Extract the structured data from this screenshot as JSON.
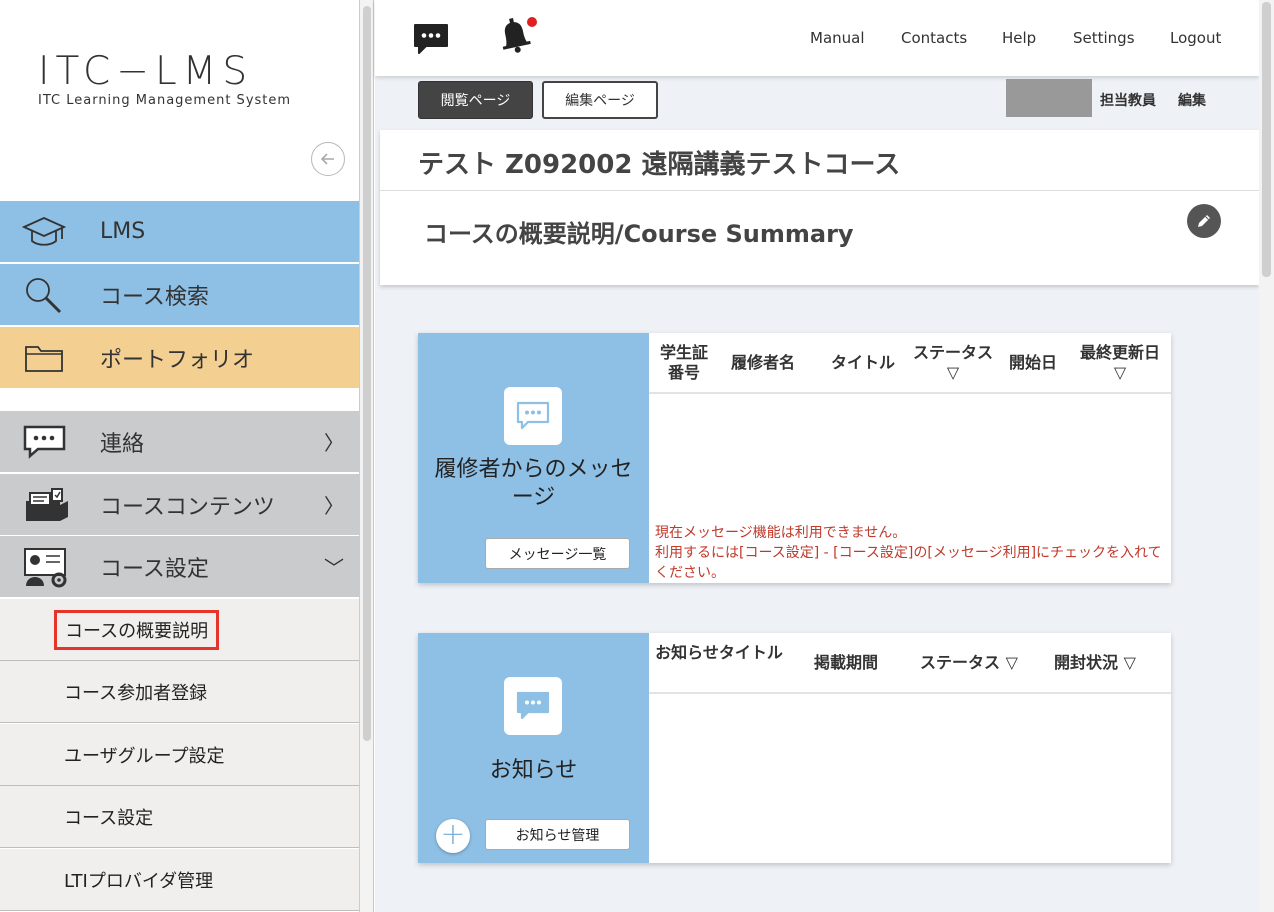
{
  "logo": {
    "main": "ITC−LMS",
    "sub": "ITC Learning Management System"
  },
  "sidebar": {
    "nav": [
      {
        "label": "LMS",
        "icon": "graduation-cap-icon"
      },
      {
        "label": "コース検索",
        "icon": "magnifier-icon"
      },
      {
        "label": "ポートフォリオ",
        "icon": "folder-icon"
      },
      {
        "label": "連絡",
        "icon": "chat-board-icon",
        "chevron": "〉"
      },
      {
        "label": "コースコンテンツ",
        "icon": "course-content-icon",
        "chevron": "〉"
      },
      {
        "label": "コース設定",
        "icon": "course-settings-icon",
        "chevron": "﹀"
      }
    ],
    "sub_items": [
      {
        "label": "コースの概要説明"
      },
      {
        "label": "コース参加者登録"
      },
      {
        "label": "ユーザグループ設定"
      },
      {
        "label": "コース設定"
      },
      {
        "label": "LTIプロバイダ管理"
      }
    ]
  },
  "header": {
    "links": [
      "Manual",
      "Contacts",
      "Help",
      "Settings",
      "Logout"
    ]
  },
  "toolbar": {
    "view_page": "閲覧ページ",
    "edit_page": "編集ページ",
    "teacher": "担当教員",
    "edit": "編集"
  },
  "course": {
    "title": "テスト Z092002 遠隔講義テストコース",
    "summary_title": "コースの概要説明/Course Summary"
  },
  "messages_panel": {
    "title": "履修者からのメッセージ",
    "button": "メッセージ一覧",
    "columns": [
      "学生証番号",
      "履修者名",
      "タイトル",
      "ステータス ▽",
      "開始日",
      "最終更新日 ▽"
    ],
    "notice_line1": "現在メッセージ機能は利用できません。",
    "notice_line2": "利用するには[コース設定] - [コース設定]の[メッセージ利用]にチェックを入れてください。"
  },
  "news_panel": {
    "title": "お知らせ",
    "button": "お知らせ管理",
    "columns": [
      "お知らせタイトル",
      "掲載期間",
      "ステータス ▽",
      "開封状況 ▽"
    ]
  },
  "colors": {
    "nav_blue": "#8ec0e6",
    "nav_orange": "#f3cf92",
    "nav_gray": "#c9cbcc",
    "notice_red": "#c0392b",
    "active_border": "#e5352b",
    "notification_dot": "#e02020"
  }
}
